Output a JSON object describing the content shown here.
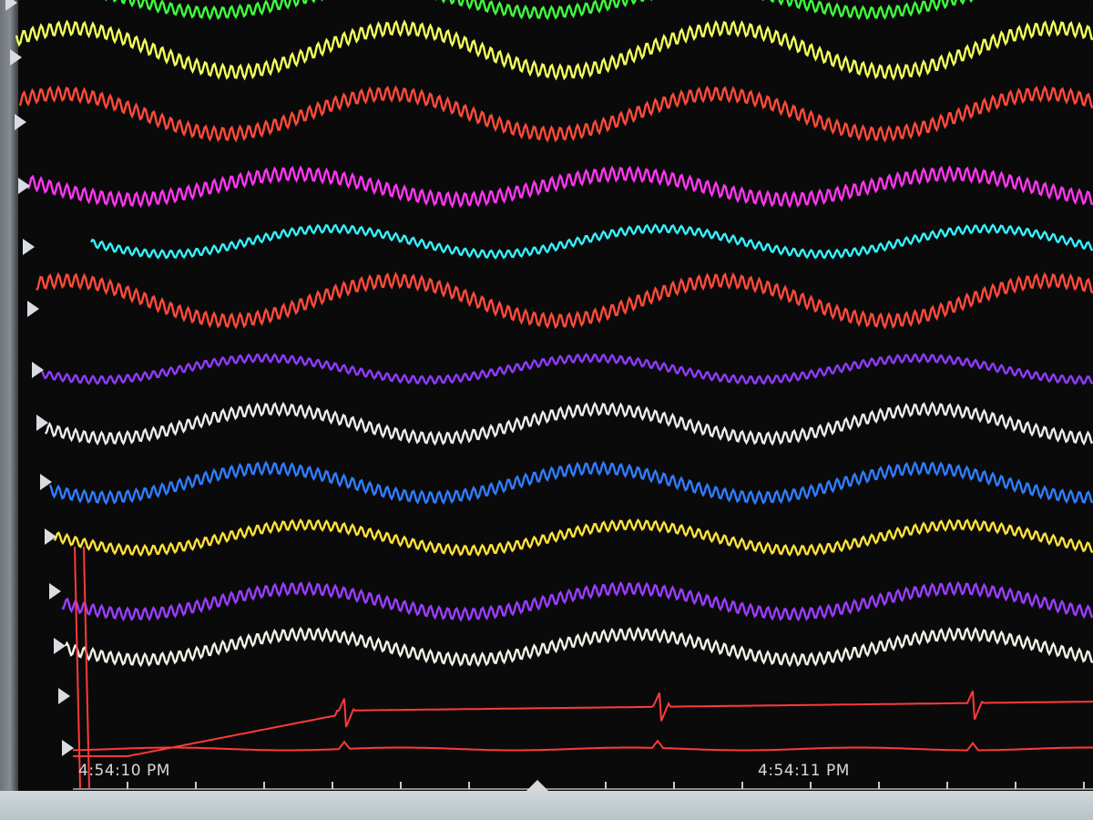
{
  "time_axis": {
    "labels": [
      "4:54:10 PM",
      "4:54:11 PM"
    ]
  },
  "colors": {
    "background": "#0b0a0b",
    "axis": "#c9c9c9",
    "time_text": "#d8d8d8"
  },
  "channels": [
    {
      "color": "#3cff3c"
    },
    {
      "color": "#f2ff5a"
    },
    {
      "color": "#ff4a3a"
    },
    {
      "color": "#ff36f0"
    },
    {
      "color": "#34f2ff"
    },
    {
      "color": "#ff4a3a"
    },
    {
      "color": "#8f3cff"
    },
    {
      "color": "#e9edf0"
    },
    {
      "color": "#2f7dff"
    },
    {
      "color": "#ffe23a"
    },
    {
      "color": "#9a3dff"
    },
    {
      "color": "#f3f0e6"
    },
    {
      "color": "#ff3a3a"
    },
    {
      "color": "#ff3a3a"
    }
  ]
}
